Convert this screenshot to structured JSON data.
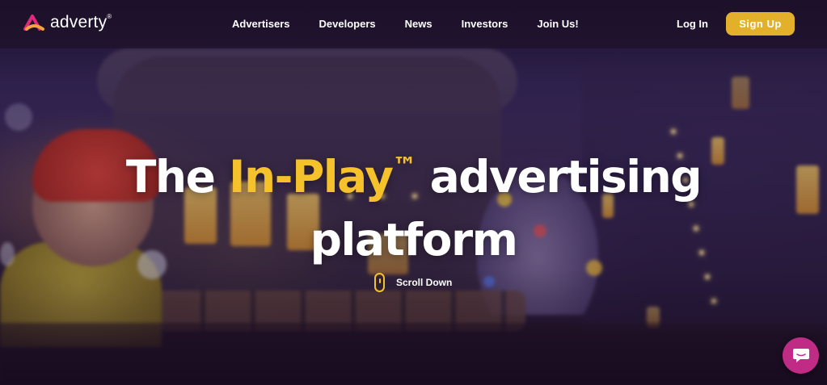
{
  "brand": {
    "name": "adverty",
    "registered_mark": "®",
    "accent_color": "#e2b02a",
    "logo_colors": [
      "#e0297a",
      "#f2a53a"
    ]
  },
  "nav": {
    "links": [
      "Advertisers",
      "Developers",
      "News",
      "Investors",
      "Join Us!"
    ],
    "login_label": "Log In",
    "signup_label": "Sign Up"
  },
  "hero": {
    "headline_prefix": "The ",
    "headline_accent": "In-Play",
    "headline_tm": "™",
    "headline_line1_suffix": " advertising",
    "headline_line2": "platform",
    "scroll_label": "Scroll Down",
    "scroll_icon": "mouse-icon"
  },
  "chat_widget": {
    "icon": "chat-bubble-icon",
    "color": "#c02b86"
  }
}
